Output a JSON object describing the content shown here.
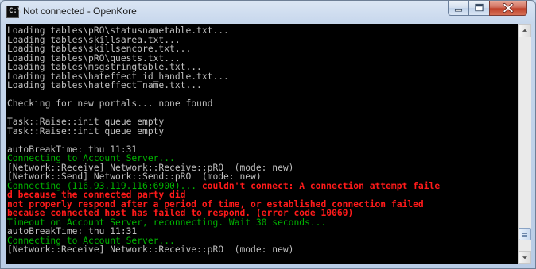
{
  "window": {
    "title": "Not connected - OpenKore",
    "icon": "console-icon",
    "icon_text": "C:\\"
  },
  "console": {
    "lines": [
      {
        "segments": [
          {
            "text": "Loading tables\\pRO\\statusnametable.txt...",
            "color": "gray"
          }
        ]
      },
      {
        "segments": [
          {
            "text": "Loading tables\\skillsarea.txt...",
            "color": "gray"
          }
        ]
      },
      {
        "segments": [
          {
            "text": "Loading tables\\skillsencore.txt...",
            "color": "gray"
          }
        ]
      },
      {
        "segments": [
          {
            "text": "Loading tables\\pRO\\quests.txt...",
            "color": "gray"
          }
        ]
      },
      {
        "segments": [
          {
            "text": "Loading tables\\msgstringtable.txt...",
            "color": "gray"
          }
        ]
      },
      {
        "segments": [
          {
            "text": "Loading tables\\hateffect_id_handle.txt...",
            "color": "gray"
          }
        ]
      },
      {
        "segments": [
          {
            "text": "Loading tables\\hateffect_name.txt...",
            "color": "gray"
          }
        ]
      },
      {
        "segments": []
      },
      {
        "segments": [
          {
            "text": "Checking for new portals... none found",
            "color": "gray"
          }
        ]
      },
      {
        "segments": []
      },
      {
        "segments": [
          {
            "text": "Task::Raise::init queue empty",
            "color": "gray"
          }
        ]
      },
      {
        "segments": [
          {
            "text": "Task::Raise::init queue empty",
            "color": "gray"
          }
        ]
      },
      {
        "segments": []
      },
      {
        "segments": [
          {
            "text": "autoBreakTime: thu 11:31",
            "color": "gray"
          }
        ]
      },
      {
        "segments": [
          {
            "text": "Connecting to Account Server...",
            "color": "green"
          }
        ]
      },
      {
        "segments": [
          {
            "text": "[Network::Receive] Network::Receive::pRO  (mode: new)",
            "color": "gray"
          }
        ]
      },
      {
        "segments": [
          {
            "text": "[Network::Send] Network::Send::pRO  (mode: new)",
            "color": "gray"
          }
        ]
      },
      {
        "segments": [
          {
            "text": "Connecting (116.93.119.116:6900)... ",
            "color": "green"
          },
          {
            "text": "couldn't connect: A connection attempt faile",
            "color": "red"
          }
        ]
      },
      {
        "segments": [
          {
            "text": "d because the connected party did",
            "color": "red"
          }
        ]
      },
      {
        "segments": [
          {
            "text": "not properly respond after a period of time, or established connection failed",
            "color": "red"
          }
        ]
      },
      {
        "segments": [
          {
            "text": "because connected host has failed to respond. (error code 10060)",
            "color": "red"
          }
        ]
      },
      {
        "segments": [
          {
            "text": "Timeout on Account Server, reconnecting. Wait 30 seconds...",
            "color": "green"
          }
        ]
      },
      {
        "segments": [
          {
            "text": "autoBreakTime: thu 11:31",
            "color": "gray"
          }
        ]
      },
      {
        "segments": [
          {
            "text": "Connecting to Account Server...",
            "color": "green"
          }
        ]
      },
      {
        "segments": [
          {
            "text": "[Network::Receive] Network::Receive::pRO  (mode: new)",
            "color": "gray"
          }
        ]
      }
    ]
  },
  "scrollbar": {
    "position": 0.95,
    "visible_fraction": 0.05
  },
  "colors": {
    "gray": "#c0c0c0",
    "green": "#00b400",
    "red": "#ff1a1a",
    "console_bg": "#000000"
  }
}
